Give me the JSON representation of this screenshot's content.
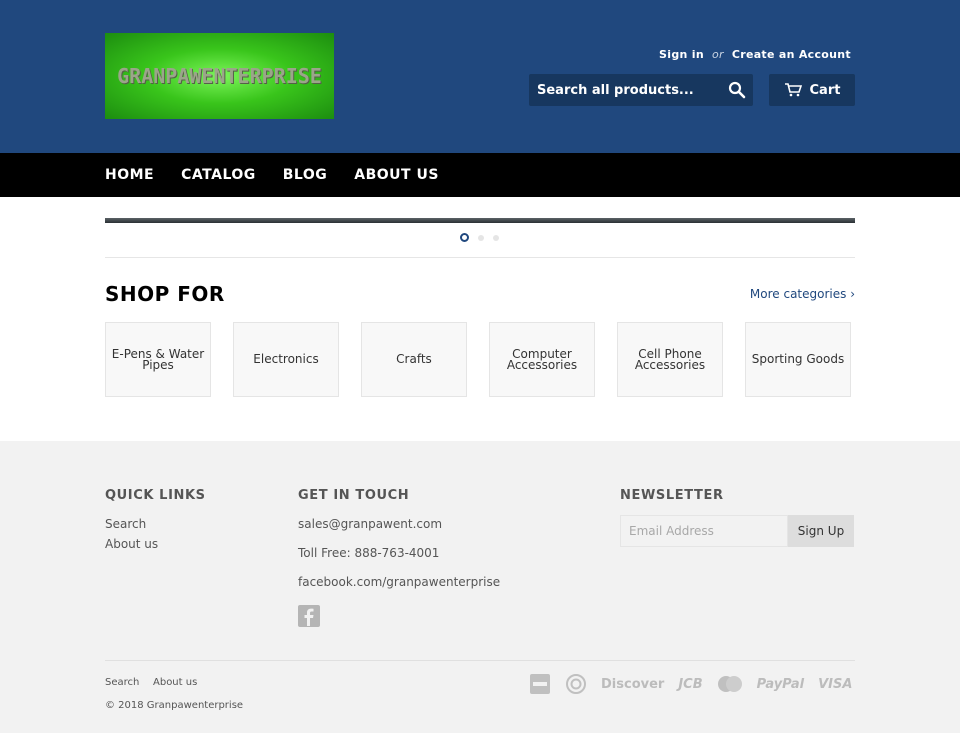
{
  "header": {
    "logo_text": "GRANPAWENTERPRISE",
    "sign_in": "Sign in",
    "or": "or",
    "create_account": "Create an Account",
    "search_placeholder": "Search all products...",
    "cart_label": "Cart"
  },
  "nav": {
    "items": [
      {
        "label": "HOME"
      },
      {
        "label": "CATALOG"
      },
      {
        "label": "BLOG"
      },
      {
        "label": "ABOUT US"
      }
    ]
  },
  "slider": {
    "dots": 3,
    "active": 0
  },
  "shop": {
    "title": "SHOP FOR",
    "more": "More categories ›",
    "categories": [
      {
        "label": "E-Pens & Water Pipes"
      },
      {
        "label": "Electronics"
      },
      {
        "label": "Crafts"
      },
      {
        "label": "Computer Accessories"
      },
      {
        "label": "Cell Phone Accessories"
      },
      {
        "label": "Sporting Goods"
      }
    ]
  },
  "footer": {
    "quick_links_title": "QUICK LINKS",
    "quick_links": [
      "Search",
      "About us"
    ],
    "contact_title": "GET IN TOUCH",
    "email": "sales@granpawent.com",
    "phone": "Toll Free: 888-763-4001",
    "facebook": "facebook.com/granpawenterprise",
    "newsletter_title": "NEWSLETTER",
    "email_placeholder": "Email Address",
    "signup_label": "Sign Up",
    "bottom_links": [
      "Search",
      "About us"
    ],
    "copyright": "© 2018 Granpawenterprise",
    "payments": [
      "Discover",
      "JCB",
      "PayPal",
      "VISA"
    ]
  },
  "colors": {
    "header_bg": "#20487e",
    "nav_bg": "#000000",
    "footer_bg": "#f2f2f2"
  }
}
